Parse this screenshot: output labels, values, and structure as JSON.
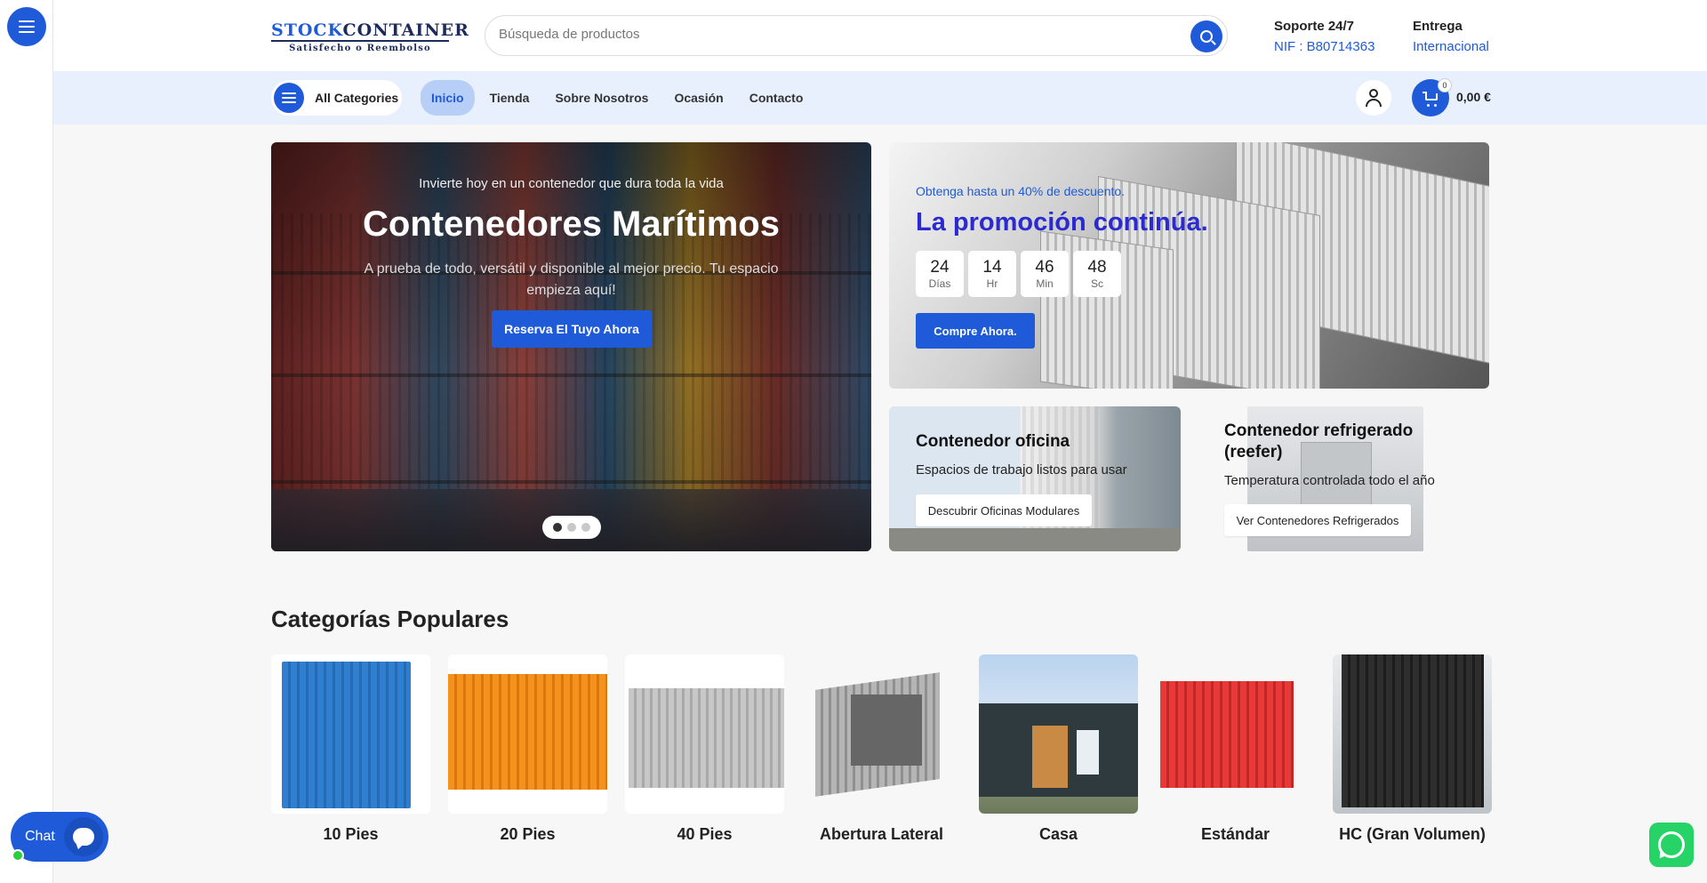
{
  "header": {
    "logo_main_a": "STOCK",
    "logo_main_b": "CONTAINER",
    "logo_sub": "Satisfecho o Reembolso",
    "search_placeholder": "Búsqueda de productos",
    "support_title": "Soporte 24/7",
    "support_value": "NIF : B80714363",
    "delivery_title": "Entrega",
    "delivery_value": "Internacional"
  },
  "nav": {
    "all_categories": "All Categories",
    "items": [
      "Inicio",
      "Tienda",
      "Sobre Nosotros",
      "Ocasión",
      "Contacto"
    ],
    "active_index": 0,
    "cart_count": "0",
    "cart_total": "0,00 €"
  },
  "hero": {
    "subtitle": "Invierte hoy en un contenedor que dura toda la vida",
    "title": "Contenedores Marítimos",
    "description": "A prueba de todo, versátil y disponible al mejor precio. Tu espacio empieza aquí!",
    "button": "Reserva El Tuyo Ahora",
    "slides": 3,
    "active_slide": 0
  },
  "promo": {
    "pre": "Obtenga hasta un 40% de descuento.",
    "title": "La promoción continúa.",
    "timer": [
      {
        "value": "24",
        "unit": "Días"
      },
      {
        "value": "14",
        "unit": "Hr"
      },
      {
        "value": "46",
        "unit": "Min"
      },
      {
        "value": "48",
        "unit": "Sc"
      }
    ],
    "button": "Compre Ahora."
  },
  "office": {
    "title": "Contenedor oficina",
    "subtitle": "Espacios de trabajo listos para usar",
    "button": "Descubrir Oficinas Modulares"
  },
  "reefer": {
    "title": "Contenedor refrigerado (reefer)",
    "subtitle": "Temperatura controlada todo el año",
    "button": "Ver Contenedores Refrigerados"
  },
  "categories": {
    "heading": "Categorías Populares",
    "items": [
      {
        "name": "10 Pies",
        "color": "#2f7fd0"
      },
      {
        "name": "20 Pies",
        "color": "#f08a1c"
      },
      {
        "name": "40 Pies",
        "color": "#bdbdbd"
      },
      {
        "name": "Abertura Lateral",
        "color": "#a9a9a9"
      },
      {
        "name": "Casa",
        "color": "#2f3a3e"
      },
      {
        "name": "Estándar",
        "color": "#e03030"
      },
      {
        "name": "HC (Gran Volumen)",
        "color": "#2a2a2a"
      }
    ]
  },
  "chat": {
    "label": "Chat"
  },
  "colors": {
    "accent": "#1f5bd8",
    "nav_background": "#e8f0fd",
    "promo_title": "#2a2ad0",
    "whatsapp": "#25d366"
  }
}
